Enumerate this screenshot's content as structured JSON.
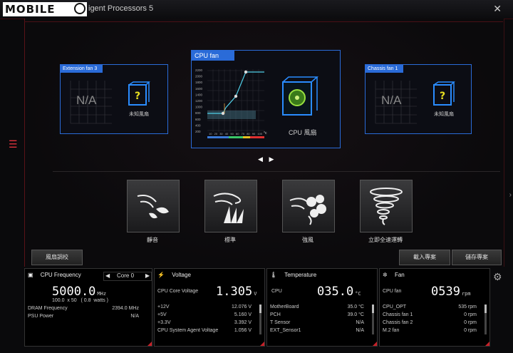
{
  "window": {
    "logo_text": "MOBILE",
    "title": "igent Processors 5",
    "close": "✕"
  },
  "fans": {
    "left": {
      "tab": "Extension fan 3",
      "status": "N/A",
      "name": "未知風扇"
    },
    "center": {
      "tab": "CPU fan",
      "name": "CPU 風扇",
      "y_ticks": [
        "2200",
        "2000",
        "1800",
        "1600",
        "1400",
        "1200",
        "1000",
        "800",
        "600",
        "400",
        "200"
      ],
      "x_ticks": [
        "10",
        "20",
        "30",
        "40",
        "50",
        "60",
        "70",
        "80",
        "90",
        "100"
      ],
      "x_unit": "°c"
    },
    "right": {
      "tab": "Chassis fan 1",
      "status": "N/A",
      "name": "未知風扇"
    }
  },
  "pager": {
    "prev": "◀",
    "next": "▶"
  },
  "modes": [
    {
      "label": "靜音"
    },
    {
      "label": "標準"
    },
    {
      "label": "強風"
    },
    {
      "label": "立即全速運轉"
    }
  ],
  "buttons": {
    "tuning": "風扇調校",
    "load": "載入專案",
    "save": "儲存專案"
  },
  "cpu_panel": {
    "title": "CPU Frequency",
    "core_select": "Core 0",
    "value": "5000.0",
    "unit": "MHz",
    "sub": "100.0  x 50   ( 0.8  watts )",
    "rows": [
      {
        "label": "DRAM Frequency",
        "value": "2394.0  MHz"
      },
      {
        "label": "PSU Power",
        "value": "N/A"
      }
    ]
  },
  "voltage_panel": {
    "title": "Voltage",
    "main_label": "CPU Core Voltage",
    "value": "1.305",
    "unit": "V",
    "rows": [
      {
        "label": "+12V",
        "value": "12.076  V"
      },
      {
        "label": "+5V",
        "value": "5.160  V"
      },
      {
        "label": "+3.3V",
        "value": "3.392  V"
      },
      {
        "label": "CPU System Agent Voltage",
        "value": "1.056  V"
      }
    ]
  },
  "temp_panel": {
    "title": "Temperature",
    "main_label": "CPU",
    "value": "035.0",
    "unit": "°C",
    "rows": [
      {
        "label": "MotherBoard",
        "value": "35.0 °C"
      },
      {
        "label": "PCH",
        "value": "39.0 °C"
      },
      {
        "label": "T Sensor",
        "value": "N/A"
      },
      {
        "label": "EXT_Sensor1",
        "value": "N/A"
      }
    ]
  },
  "fan_panel": {
    "title": "Fan",
    "main_label": "CPU fan",
    "value": "0539",
    "unit": "rpm",
    "rows": [
      {
        "label": "CPU_OPT",
        "value": "535  rpm"
      },
      {
        "label": "Chassis fan 1",
        "value": "0  rpm"
      },
      {
        "label": "Chassis fan 2",
        "value": "0  rpm"
      },
      {
        "label": "M.2 fan",
        "value": "0  rpm"
      }
    ]
  },
  "colors": {
    "accent_red": "#c82028",
    "card_blue": "#2a6bd8",
    "curve_cyan": "#4fd0e8"
  },
  "icons": [
    "menu-icon",
    "close-icon",
    "cpu-icon",
    "lightning-icon",
    "thermometer-icon",
    "fan-icon",
    "gear-icon"
  ]
}
